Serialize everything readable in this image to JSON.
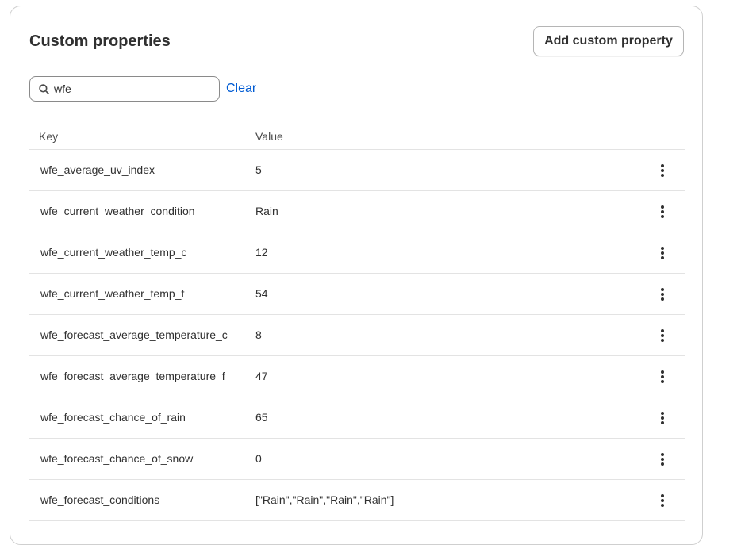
{
  "section": {
    "title": "Custom properties",
    "add_button_label": "Add custom property"
  },
  "search": {
    "value": "wfe",
    "clear_label": "Clear",
    "icon": "search-icon"
  },
  "table": {
    "columns": [
      "Key",
      "Value"
    ],
    "row_action_icon": "more-vertical-icon",
    "rows": [
      {
        "key": "wfe_average_uv_index",
        "value": "5"
      },
      {
        "key": "wfe_current_weather_condition",
        "value": "Rain"
      },
      {
        "key": "wfe_current_weather_temp_c",
        "value": "12"
      },
      {
        "key": "wfe_current_weather_temp_f",
        "value": "54"
      },
      {
        "key": "wfe_forecast_average_temperature_c",
        "value": "8"
      },
      {
        "key": "wfe_forecast_average_temperature_f",
        "value": "47"
      },
      {
        "key": "wfe_forecast_chance_of_rain",
        "value": "65"
      },
      {
        "key": "wfe_forecast_chance_of_snow",
        "value": "0"
      },
      {
        "key": "wfe_forecast_conditions",
        "value": "[\"Rain\",\"Rain\",\"Rain\",\"Rain\"]"
      }
    ]
  },
  "colors": {
    "link": "#005bd3",
    "text": "#303030",
    "border": "#e3e3e3"
  }
}
